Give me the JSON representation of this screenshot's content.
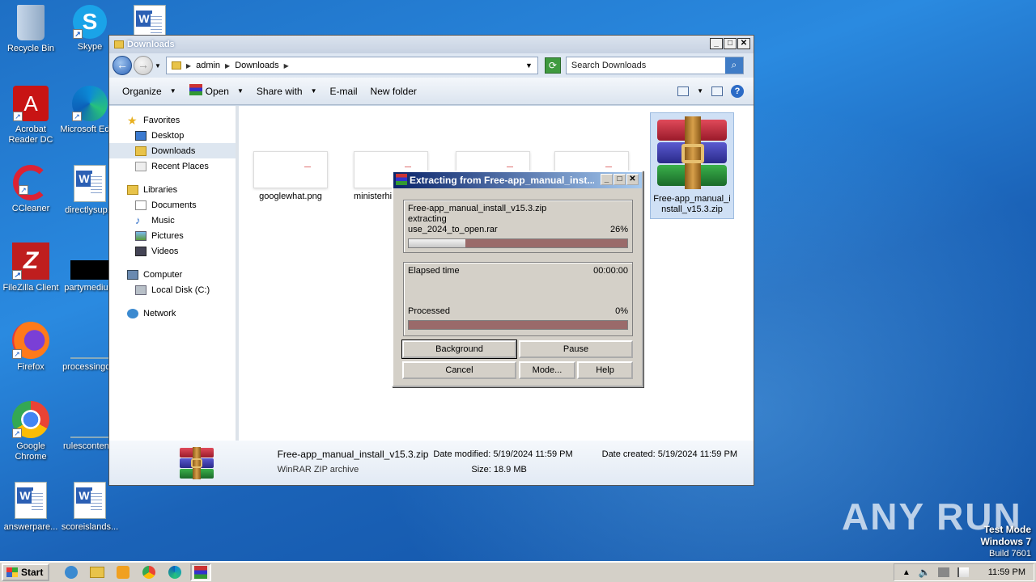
{
  "desktop": {
    "icons": [
      {
        "label": "Recycle Bin"
      },
      {
        "label": "Skype"
      },
      {
        "label": "Acrobat Reader DC"
      },
      {
        "label": "Microsoft Edge"
      },
      {
        "label": "CCleaner"
      },
      {
        "label": "directlysup..."
      },
      {
        "label": "FileZilla Client"
      },
      {
        "label": "partymediu..."
      },
      {
        "label": "Firefox"
      },
      {
        "label": "processingc..."
      },
      {
        "label": "Google Chrome"
      },
      {
        "label": "rulesconten..."
      },
      {
        "label": "answerpare..."
      },
      {
        "label": "scoreislands..."
      }
    ]
  },
  "explorer": {
    "title": "Downloads",
    "breadcrumb": [
      "admin",
      "Downloads"
    ],
    "search_placeholder": "Search Downloads",
    "toolbar": {
      "organize": "Organize",
      "open": "Open",
      "share_with": "Share with",
      "email": "E-mail",
      "new_folder": "New folder"
    },
    "nav": {
      "favorites": "Favorites",
      "desktop": "Desktop",
      "downloads": "Downloads",
      "recent_places": "Recent Places",
      "libraries": "Libraries",
      "documents": "Documents",
      "music": "Music",
      "pictures": "Pictures",
      "videos": "Videos",
      "computer": "Computer",
      "local_disk": "Local Disk (C:)",
      "network": "Network"
    },
    "files": [
      {
        "name": "googlewhat.png"
      },
      {
        "name": "ministerhi..."
      },
      {
        "name": "Free-app_manual_install_v15.3.zip"
      }
    ],
    "details": {
      "filename": "Free-app_manual_install_v15.3.zip",
      "type": "WinRAR ZIP archive",
      "date_modified": "Date modified: 5/19/2024 11:59 PM",
      "size": "Size: 18.9 MB",
      "date_created": "Date created: 5/19/2024 11:59 PM"
    }
  },
  "winrar": {
    "title": "Extracting from Free-app_manual_inst...",
    "archive": "Free-app_manual_install_v15.3.zip",
    "action": "extracting",
    "current_file": "use_2024_to_open.rar",
    "file_percent": "26%",
    "file_progress": 0.26,
    "elapsed_label": "Elapsed time",
    "elapsed_value": "00:00:00",
    "processed_label": "Processed",
    "processed_percent": "0%",
    "processed_progress": 0.0,
    "buttons": {
      "background": "Background",
      "pause": "Pause",
      "cancel": "Cancel",
      "mode": "Mode...",
      "help": "Help"
    }
  },
  "watermark": "ANY RUN",
  "testmode": {
    "line1": "Test Mode",
    "line2": "Windows 7",
    "line3": "Build 7601"
  },
  "taskbar": {
    "start": "Start",
    "clock": "11:59 PM"
  }
}
